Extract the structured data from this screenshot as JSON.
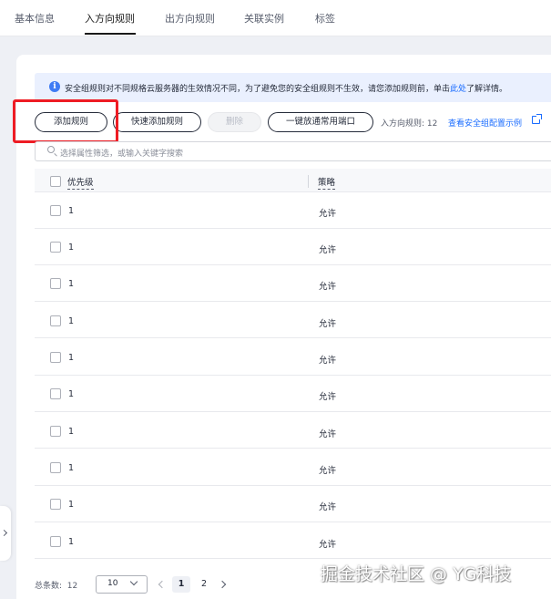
{
  "tabs": [
    {
      "label": "基本信息"
    },
    {
      "label": "入方向规则"
    },
    {
      "label": "出方向规则"
    },
    {
      "label": "关联实例"
    },
    {
      "label": "标签"
    }
  ],
  "alert": {
    "text_before": "安全组规则对不同规格云服务器的生效情况不同，为了避免您的安全组规则不生效，请您添加规则前，单击",
    "link": "此处",
    "text_after": "了解详情。"
  },
  "toolbar": {
    "add_rule": "添加规则",
    "quick_add": "快速添加规则",
    "delete": "删除",
    "open_common_ports": "一键放通常用端口",
    "rule_count": "入方向规则: 12",
    "example_link": "查看安全组配置示例"
  },
  "search": {
    "placeholder": "选择属性筛选，或输入关键字搜索"
  },
  "table": {
    "columns": [
      "优先级",
      "策略"
    ],
    "rows": [
      {
        "priority": "1",
        "policy": "允许"
      },
      {
        "priority": "1",
        "policy": "允许"
      },
      {
        "priority": "1",
        "policy": "允许"
      },
      {
        "priority": "1",
        "policy": "允许"
      },
      {
        "priority": "1",
        "policy": "允许"
      },
      {
        "priority": "1",
        "policy": "允许"
      },
      {
        "priority": "1",
        "policy": "允许"
      },
      {
        "priority": "1",
        "policy": "允许"
      },
      {
        "priority": "1",
        "policy": "允许"
      },
      {
        "priority": "1",
        "policy": "允许"
      }
    ]
  },
  "pagination": {
    "total_label": "总条数:",
    "total": "12",
    "page_size": "10",
    "pages": [
      "1",
      "2"
    ],
    "current_page": "1"
  },
  "watermark": "掘金技术社区 @ YG科技",
  "colors": {
    "link": "#1a6cff",
    "alert_bg": "#eaf0fe",
    "highlight": "#ee1c24",
    "text": "#252b3a"
  }
}
